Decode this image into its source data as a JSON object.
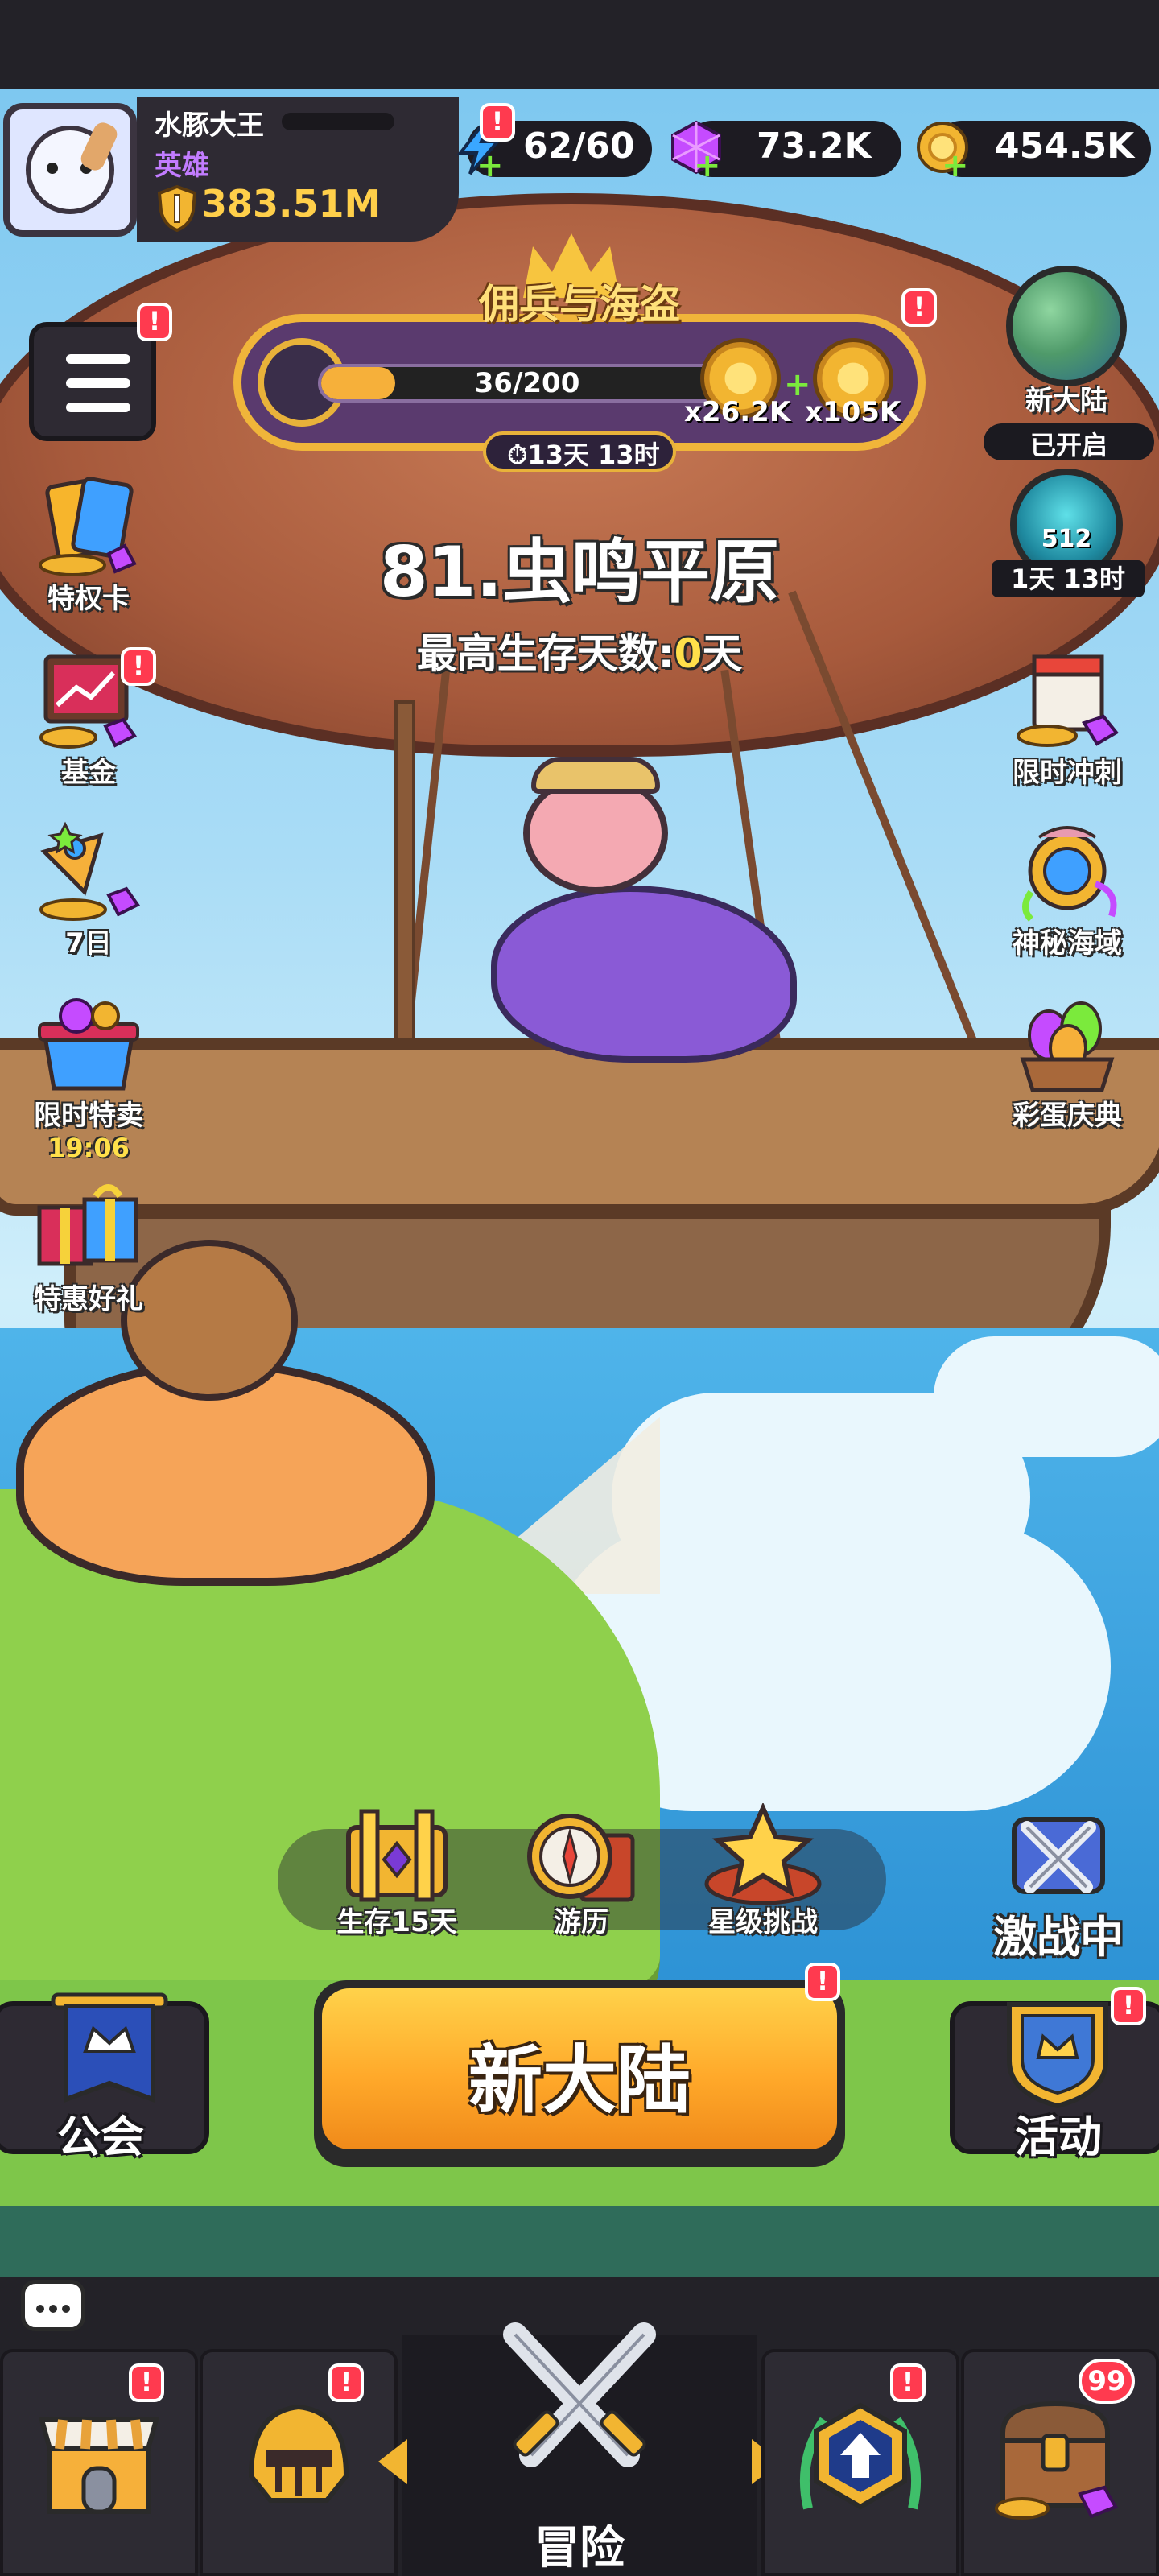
{
  "player": {
    "name": "水豚大王",
    "title": "英雄",
    "power": "383.51M"
  },
  "resources": {
    "energy": "62/60",
    "gems": "73.2K",
    "coins": "454.5K"
  },
  "event": {
    "title": "佣兵与海盗",
    "progress_text": "36/200",
    "progress_fraction": 0.18,
    "reward_1": "x26.2K",
    "reward_2": "x105K",
    "timer": "13天 13时"
  },
  "stage": {
    "title": "81.虫鸣平原",
    "subtitle_prefix": "最高生存天数:",
    "subtitle_value": "0",
    "subtitle_suffix": "天"
  },
  "left_menu": [
    {
      "label": "特权卡",
      "icon": "privilege-card-icon"
    },
    {
      "label": "基金",
      "icon": "fund-icon"
    },
    {
      "label": "7日",
      "icon": "seven-day-icon"
    },
    {
      "label": "限时特卖",
      "icon": "limited-sale-icon",
      "sub": "19:06"
    },
    {
      "label": "特惠好礼",
      "icon": "special-gift-icon"
    }
  ],
  "right_menu": {
    "new_continent": {
      "label": "新大陆",
      "status": "已开启"
    },
    "ring": {
      "number": "512",
      "time": "1天 13时"
    },
    "items": [
      {
        "label": "限时冲刺",
        "icon": "limited-sprint-icon"
      },
      {
        "label": "神秘海域",
        "icon": "mystery-sea-icon"
      },
      {
        "label": "彩蛋庆典",
        "icon": "egg-festival-icon"
      }
    ]
  },
  "features": [
    {
      "label": "生存15天",
      "icon": "survival-chest-icon"
    },
    {
      "label": "游历",
      "icon": "travel-compass-icon"
    },
    {
      "label": "星级挑战",
      "icon": "star-challenge-icon"
    }
  ],
  "battle": {
    "label": "激战中"
  },
  "buttons": {
    "guild": "公会",
    "main": "新大陆",
    "activity": "活动"
  },
  "bottom_nav": {
    "center_label": "冒险",
    "chest_badge": "99"
  },
  "badges": {
    "alert": "!"
  }
}
